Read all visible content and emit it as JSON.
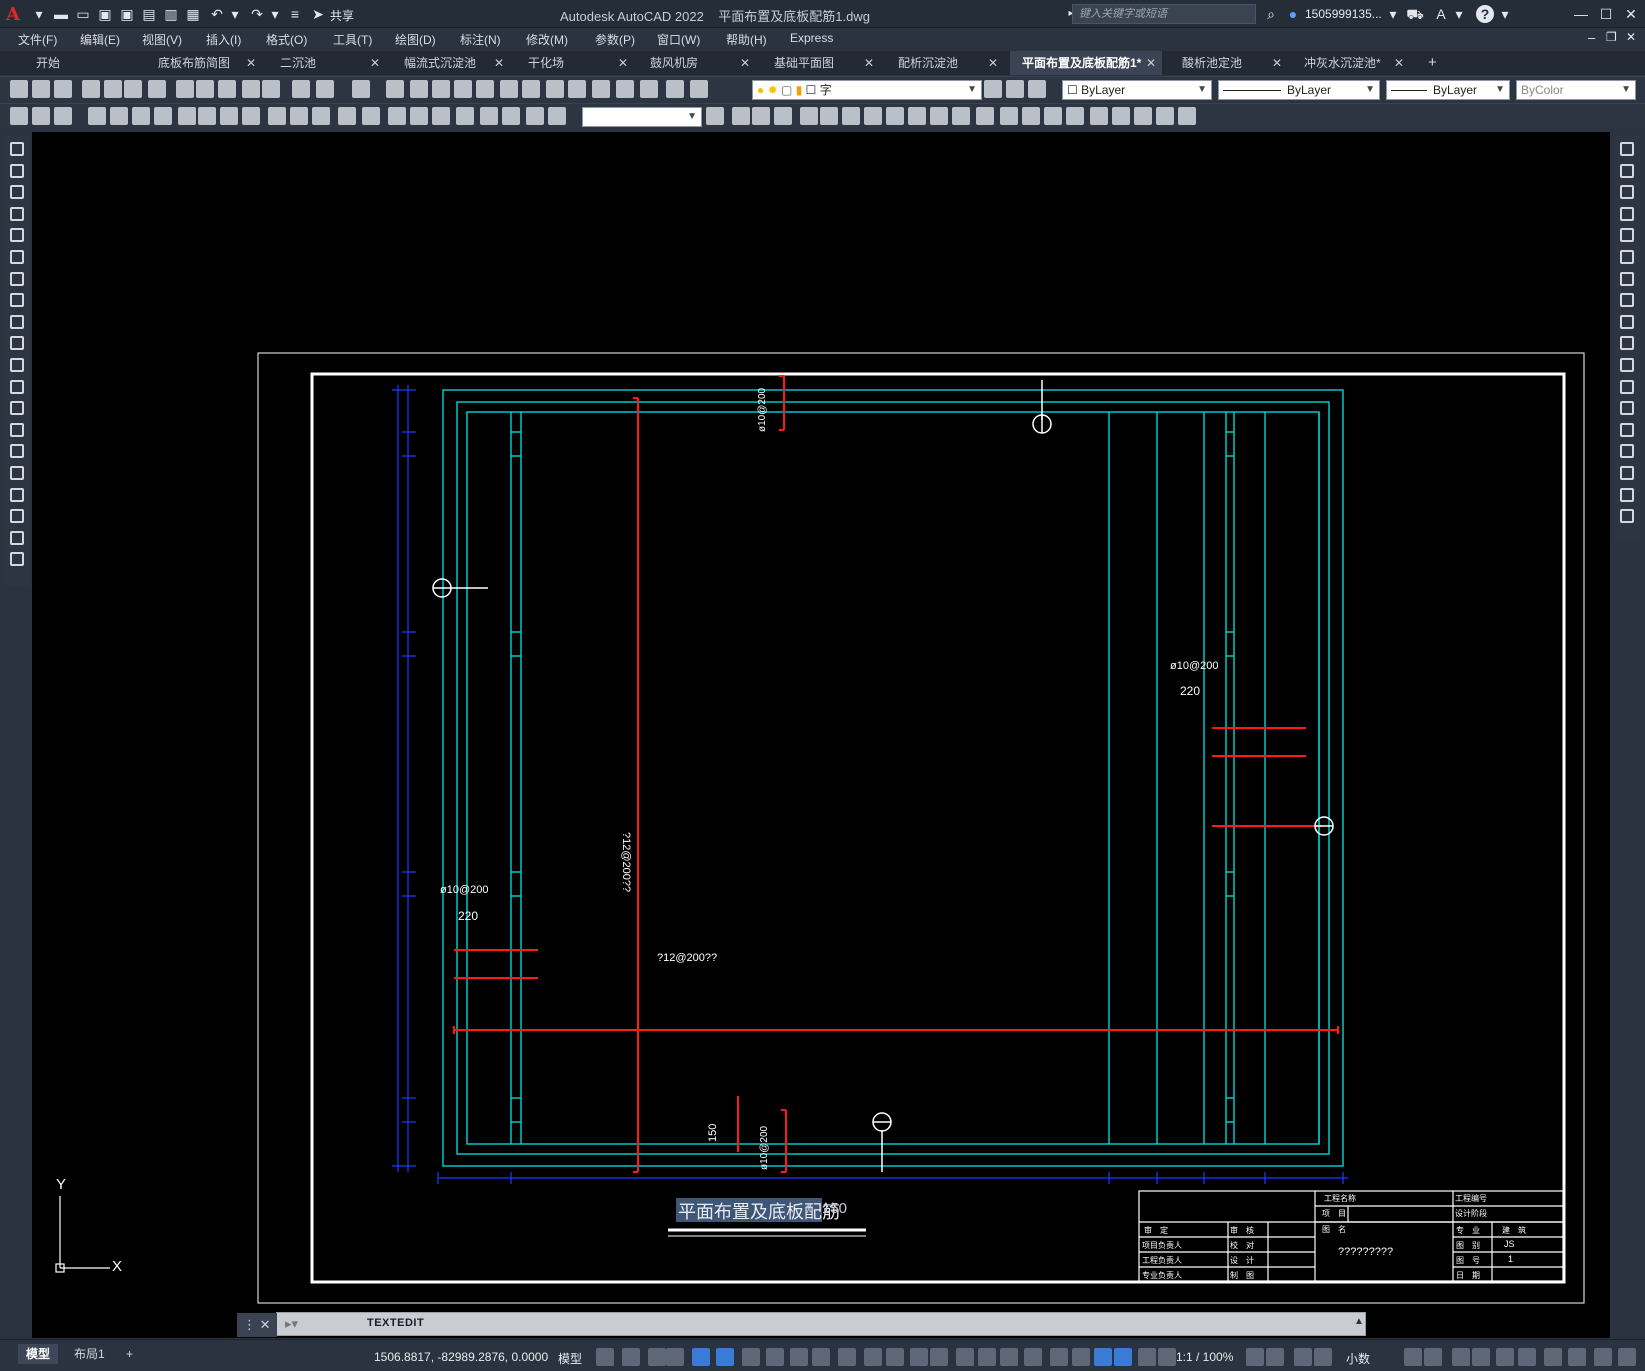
{
  "app": {
    "logo": "A",
    "title": "Autodesk AutoCAD 2022    平面布置及底板配筋1.dwg",
    "share_label": "共享",
    "search_placeholder": "键入关键字或短语",
    "user": "1505999135...",
    "help": "?"
  },
  "menu": [
    "文件(F)",
    "编辑(E)",
    "视图(V)",
    "插入(I)",
    "格式(O)",
    "工具(T)",
    "绘图(D)",
    "标注(N)",
    "修改(M)",
    "参数(P)",
    "窗口(W)",
    "帮助(H)",
    "Express"
  ],
  "tabs": [
    {
      "label": "开始",
      "closable": false,
      "active": false
    },
    {
      "label": "底板布筋简图",
      "closable": true,
      "active": false
    },
    {
      "label": "二沉池",
      "closable": true,
      "active": false
    },
    {
      "label": "幅流式沉淀池",
      "closable": true,
      "active": false
    },
    {
      "label": "干化场",
      "closable": true,
      "active": false
    },
    {
      "label": "鼓风机房",
      "closable": true,
      "active": false
    },
    {
      "label": "基础平面图",
      "closable": true,
      "active": false
    },
    {
      "label": "配析沉淀池",
      "closable": true,
      "active": false
    },
    {
      "label": "平面布置及底板配筋1*",
      "closable": true,
      "active": true
    },
    {
      "label": "酸析池定池",
      "closable": true,
      "active": false
    },
    {
      "label": "冲灰水沉淀池*",
      "closable": true,
      "active": false
    }
  ],
  "props": {
    "layer_text": "字",
    "color": "ByLayer",
    "linetype": "ByLayer",
    "lineweight": "ByLayer",
    "plotstyle": "ByColor"
  },
  "drawing": {
    "title": "平面布置及底板配筋",
    "scale": "150",
    "labels": {
      "top_rebar": "ø10@200",
      "right_rebar": "ø10@200",
      "right_dim": "220",
      "left_rebar": "ø10@200",
      "left_dim": "220",
      "horizontal_rebar": "?12@200??",
      "vertical_rebar": "?12@200??",
      "bottom_dim": "150",
      "bottom_rebar": "ø10@200"
    },
    "title_block": {
      "project_name_label": "工程名称",
      "project_no_label": "工程编号",
      "item_label": "项　目",
      "stage_label": "设计阶段",
      "drawing_name_label": "图　名",
      "drawing_name_value": "?????????",
      "roles": [
        "审　定",
        "项目负责人",
        "工程负责人",
        "专业负责人"
      ],
      "checks": [
        "审　核",
        "校　对",
        "设　计",
        "制　图"
      ],
      "right_labels": [
        "专　业",
        "图　别",
        "图　号",
        "日　期"
      ],
      "right_values": [
        "建　筑",
        "JS",
        "1",
        ""
      ]
    }
  },
  "ucs": {
    "x": "X",
    "y": "Y"
  },
  "command_line": "TEXTEDIT",
  "status": {
    "model_tab": "模型",
    "layout_tab": "布局1",
    "add_tab": "+",
    "coordinates": "1506.8817, -82989.2876, 0.0000",
    "space": "模型",
    "scale": "1:1 / 100%",
    "units": "小数"
  },
  "colors": {
    "cyan": "#00c8c8",
    "red": "#ff1a1a",
    "blue": "#1a3cff",
    "white": "#ffffff",
    "accent": "#3a7bd5"
  }
}
